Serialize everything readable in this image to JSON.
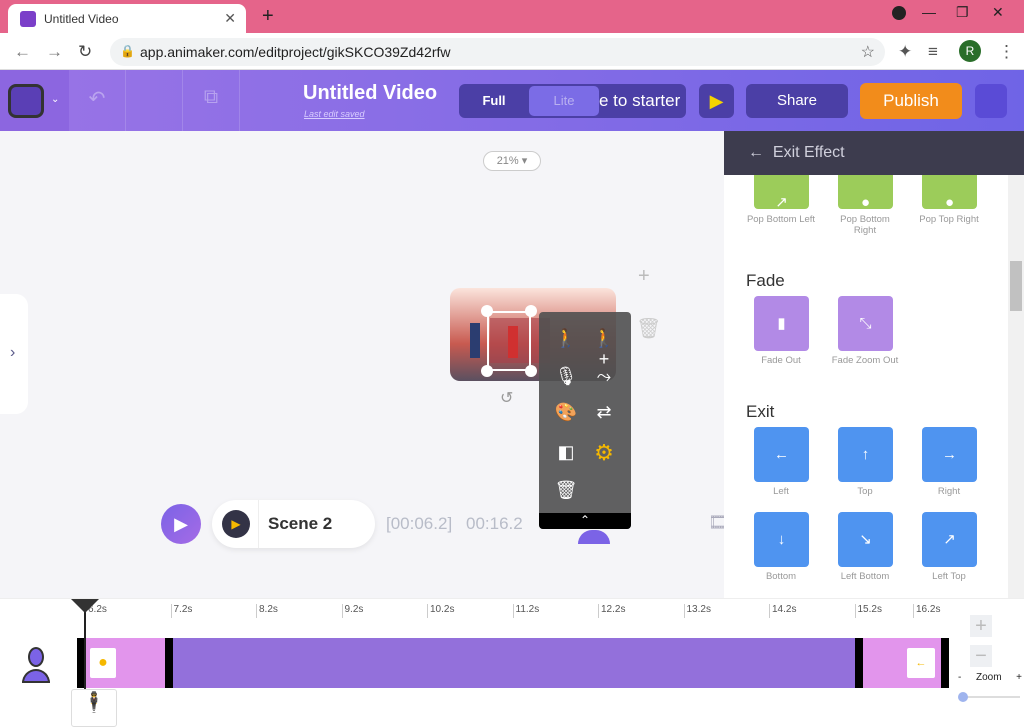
{
  "browser": {
    "tab_title": "Untitled Video",
    "url": "app.animaker.com/editproject/gikSKCO39Zd42rfw",
    "profile_initial": "R"
  },
  "header": {
    "title": "Untitled Video",
    "saved": "Last edit saved",
    "mode_full": "Full",
    "mode_lite": "Lite",
    "starter": "e to starter",
    "share": "Share",
    "publish": "Publish"
  },
  "canvas": {
    "zoom": "21%",
    "scene_name": "Scene 2",
    "current_time": "[00:06.2]",
    "total_time": "00:16.2"
  },
  "panel": {
    "title": "Exit Effect",
    "pop_items": [
      "Pop Bottom Left",
      "Pop Bottom Right",
      "Pop Top Right"
    ],
    "fade_title": "Fade",
    "fade_items": [
      "Fade Out",
      "Fade Zoom Out"
    ],
    "exit_title": "Exit",
    "exit_items": [
      {
        "label": "Left",
        "icon": "←"
      },
      {
        "label": "Top",
        "icon": "↑"
      },
      {
        "label": "Right",
        "icon": "→"
      },
      {
        "label": "Bottom",
        "icon": "↓"
      },
      {
        "label": "Left Bottom",
        "icon": "↘"
      },
      {
        "label": "Left Top",
        "icon": "↗"
      }
    ]
  },
  "timeline": {
    "ticks": [
      "6.2s",
      "7.2s",
      "8.2s",
      "9.2s",
      "10.2s",
      "11.2s",
      "12.2s",
      "13.2s",
      "14.2s",
      "15.2s",
      "16.2s"
    ],
    "zoom_label": "Zoom",
    "zoom_minus": "-",
    "zoom_plus": "+"
  },
  "colors": {
    "accent": "#7b63e6",
    "publish": "#f28c1b",
    "pop": "#9ccc5a",
    "fade": "#b28ae6",
    "exit": "#4f94f0",
    "track": "#9370db",
    "track_effect": "#e295ec"
  }
}
